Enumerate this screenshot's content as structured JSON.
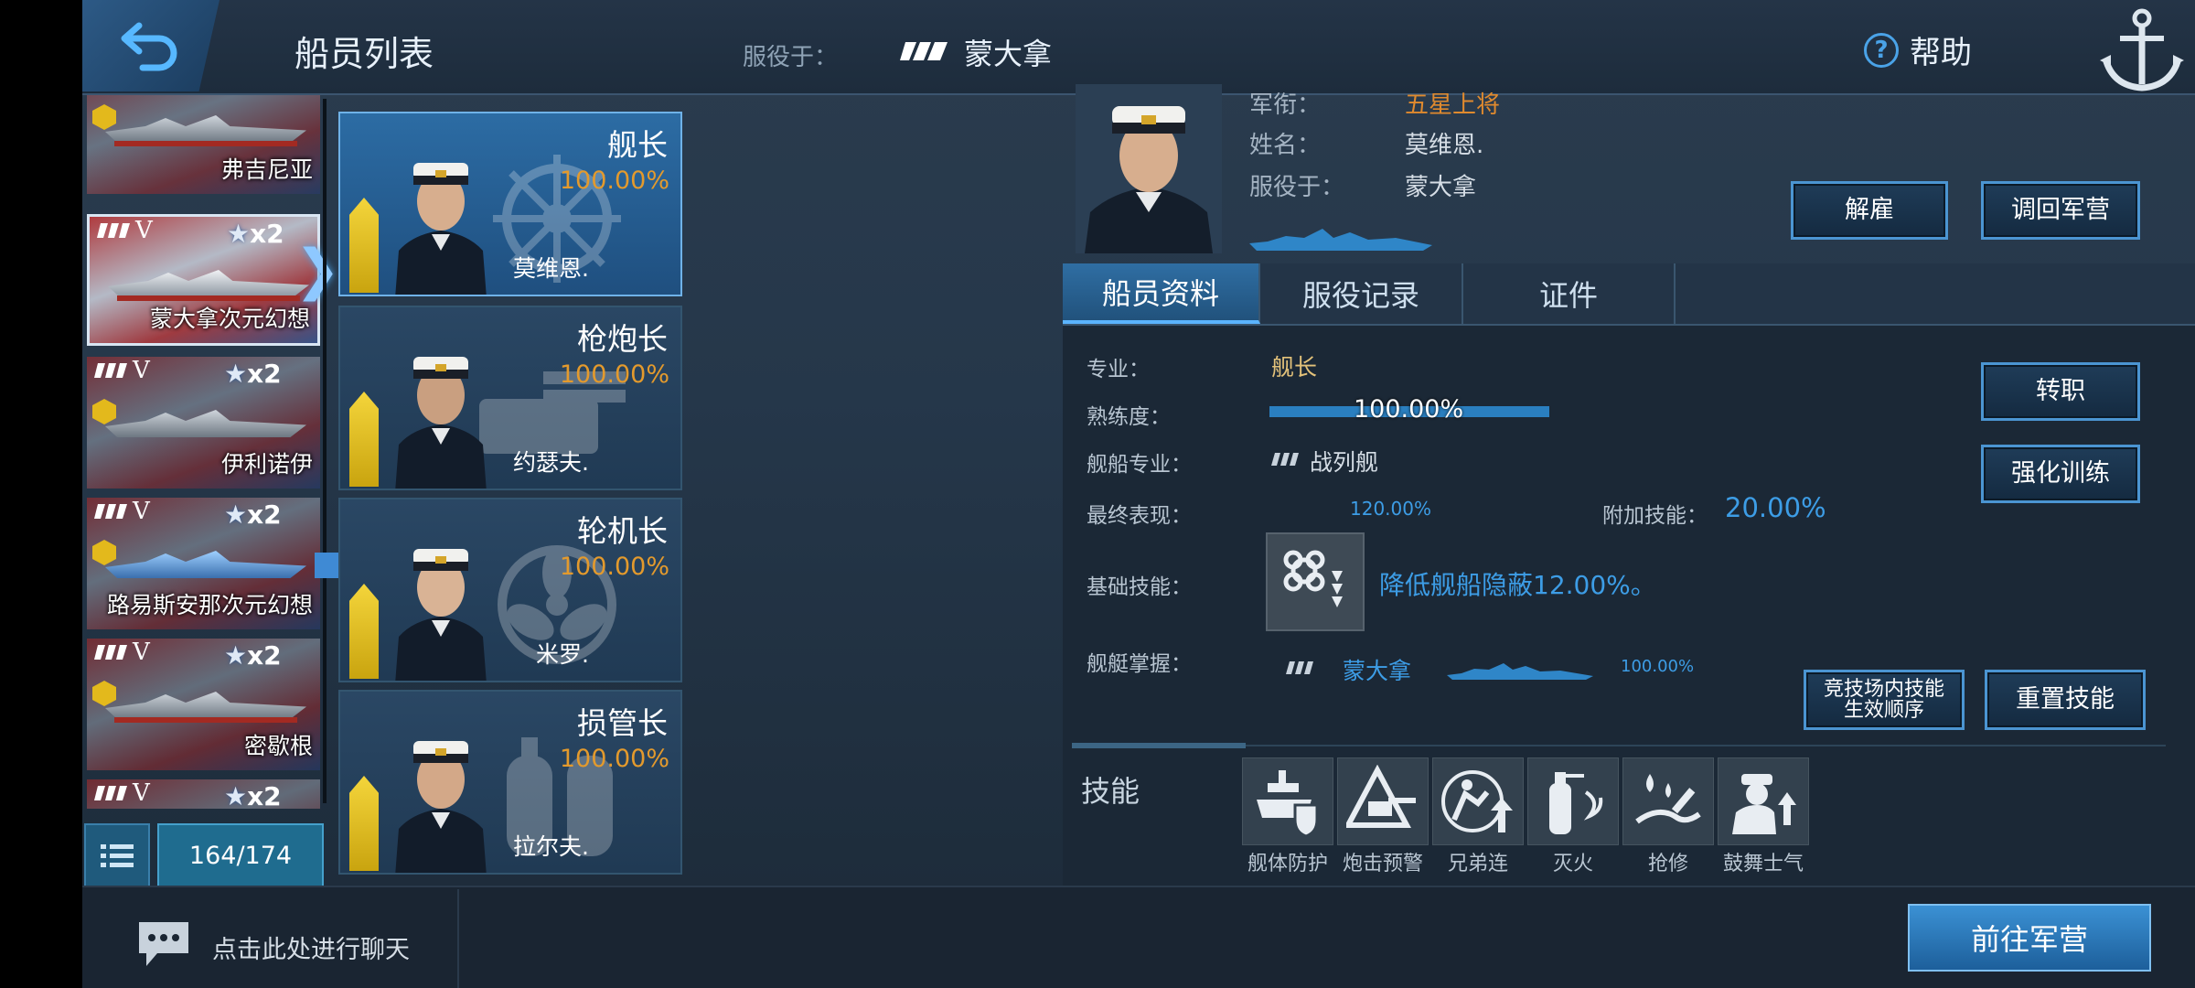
{
  "header": {
    "title": "船员列表",
    "serve_label": "服役于：",
    "serve_value": "蒙大拿",
    "help_label": "帮助"
  },
  "ship_list": [
    {
      "tier": "",
      "x2": "x2",
      "name": "弗吉尼亚"
    },
    {
      "tier": "V",
      "x2": "x2",
      "name": "蒙大拿次元幻想"
    },
    {
      "tier": "V",
      "x2": "x2",
      "name": "伊利诺伊"
    },
    {
      "tier": "V",
      "x2": "x2",
      "name": "路易斯安那次元幻想"
    },
    {
      "tier": "V",
      "x2": "x2",
      "name": "密歇根"
    },
    {
      "tier": "V",
      "x2": "x2",
      "name": ""
    }
  ],
  "list_count": "164/174",
  "crew": [
    {
      "role": "舰长",
      "pct": "100.00%",
      "name": "莫维恩."
    },
    {
      "role": "枪炮长",
      "pct": "100.00%",
      "name": "约瑟夫."
    },
    {
      "role": "轮机长",
      "pct": "100.00%",
      "name": "米罗."
    },
    {
      "role": "损管长",
      "pct": "100.00%",
      "name": "拉尔夫."
    }
  ],
  "detail": {
    "rank_label": "军衔：",
    "rank_value": "五星上将",
    "name_label": "姓名：",
    "name_value": "莫维恩.",
    "serve_label": "服役于：",
    "serve_value": "蒙大拿",
    "dismiss_button": "解雇",
    "recall_button": "调回军营",
    "tabs": [
      "船员资料",
      "服役记录",
      "证件"
    ],
    "specialty_label": "专业：",
    "specialty_value": "舰长",
    "proficiency_label": "熟练度：",
    "proficiency_value": "100.00%",
    "ship_type_label": "舰船专业：",
    "ship_type_value": "战列舰",
    "final_label": "最终表现：",
    "final_value": "120.00%",
    "extra_label": "附加技能：",
    "extra_value": "20.00%",
    "base_skill_label": "基础技能：",
    "base_skill_value": "降低舰船隐蔽12.00%。",
    "mastery_label": "舰艇掌握：",
    "mastery_ship": "蒙大拿",
    "mastery_pct": "100.00%",
    "transfer_button": "转职",
    "train_button": "强化训练",
    "arena_button": "竞技场内技能生效顺序",
    "arena_line1": "竞技场内技能",
    "arena_line2": "生效顺序",
    "reset_button": "重置技能",
    "skills_label": "技能",
    "skills": [
      "舰体防护",
      "炮击预警",
      "兄弟连",
      "灭火",
      "抢修",
      "鼓舞士气"
    ]
  },
  "footer": {
    "chat_text": "点击此处进行聊天",
    "go_button": "前往军营"
  },
  "colors": {
    "accent_blue": "#3d9de6",
    "gold": "#e08a2e",
    "rank_yellow": "#f4d53b"
  }
}
